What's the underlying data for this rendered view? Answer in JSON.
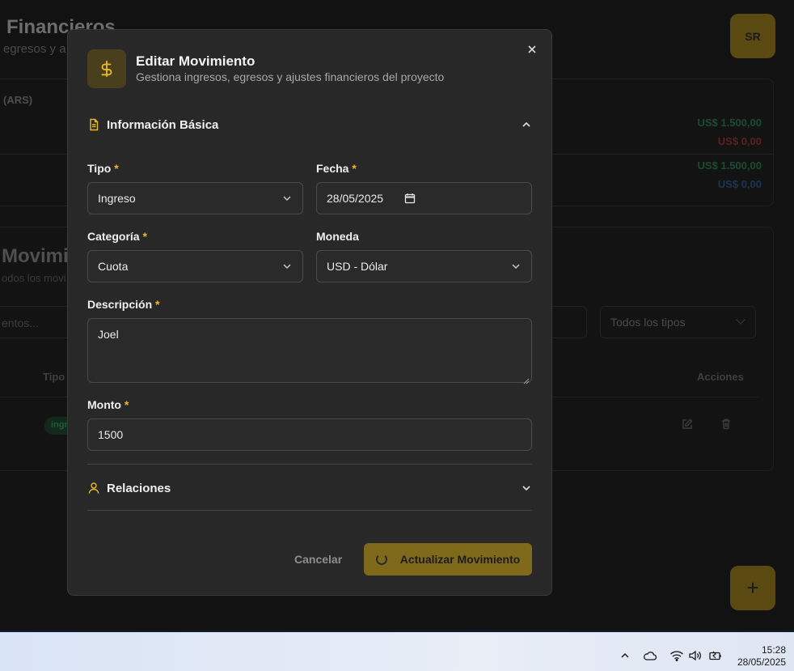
{
  "background": {
    "title": "Financieros",
    "subtitle": "egresos y a",
    "avatar_initials": "SR",
    "card_currency_label": "(ARS)",
    "money_values": [
      "US$ 1.500,00",
      "US$ 0,00",
      "US$ 1.500,00",
      "US$ 0,00"
    ],
    "movements_title": "Movimi",
    "movements_subtitle": "odos los movi",
    "search_placeholder": "entos...",
    "type_filter": "Todos los tipos",
    "col_tipo": "Tipo",
    "col_acciones": "Acciones",
    "row_badge": "ingreso",
    "fab_label": "+"
  },
  "modal": {
    "title": "Editar Movimiento",
    "subtitle": "Gestiona ingresos, egresos y ajustes financieros del proyecto",
    "section_basic": "Información Básica",
    "section_relations": "Relaciones",
    "tipo": {
      "label": "Tipo",
      "required": "*",
      "value": "Ingreso"
    },
    "fecha": {
      "label": "Fecha",
      "required": "*",
      "value": "28/05/2025"
    },
    "categoria": {
      "label": "Categoría",
      "required": "*",
      "value": "Cuota"
    },
    "moneda": {
      "label": "Moneda",
      "value": "USD - Dólar"
    },
    "descripcion": {
      "label": "Descripción",
      "required": "*",
      "value": "Joel"
    },
    "monto": {
      "label": "Monto",
      "required": "*",
      "value": "1500"
    },
    "cancel_label": "Cancelar",
    "submit_label": "Actualizar Movimiento"
  },
  "taskbar": {
    "time": "15:28",
    "date": "28/05/2025"
  },
  "colors": {
    "accent": "#eab82a",
    "modal_bg": "#282828",
    "submit_bg": "#7f6a1c"
  }
}
